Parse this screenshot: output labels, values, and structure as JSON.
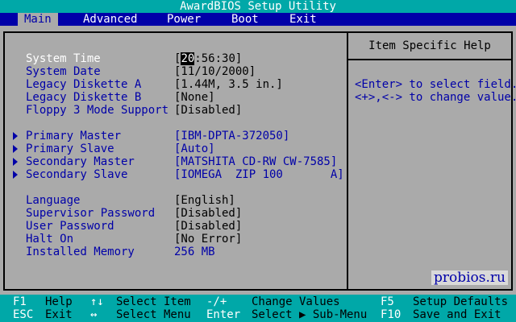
{
  "title": "AwardBIOS Setup Utility",
  "menu": [
    {
      "label": "Main",
      "active": true
    },
    {
      "label": "Advanced"
    },
    {
      "label": "Power"
    },
    {
      "label": "Boot"
    },
    {
      "label": "Exit"
    }
  ],
  "settings": {
    "system_time": {
      "label": "System Time",
      "cursor": "20",
      "rest": ":56:30]",
      "open": "["
    },
    "system_date": {
      "label": "System Date",
      "value": "[11/10/2000]"
    },
    "legacy_a": {
      "label": "Legacy Diskette A",
      "value": "[1.44M, 3.5 in.]"
    },
    "legacy_b": {
      "label": "Legacy Diskette B",
      "value": "[None]"
    },
    "floppy3": {
      "label": "Floppy 3 Mode Support",
      "value": "[Disabled]"
    },
    "primary_master": {
      "label": "Primary Master",
      "value": "[IBM-DPTA-372050]"
    },
    "primary_slave": {
      "label": "Primary Slave",
      "value": "[Auto]"
    },
    "secondary_master": {
      "label": "Secondary Master",
      "value": "[MATSHITA CD-RW CW-7585]"
    },
    "secondary_slave": {
      "label": "Secondary Slave",
      "value": "[IOMEGA  ZIP 100       A]"
    },
    "language": {
      "label": "Language",
      "value": "[English]"
    },
    "supervisor_password": {
      "label": "Supervisor Password",
      "value": "[Disabled]"
    },
    "user_password": {
      "label": "User Password",
      "value": "[Disabled]"
    },
    "halt_on": {
      "label": "Halt On",
      "value": "[No Error]"
    },
    "installed_memory": {
      "label": "Installed Memory",
      "value": "256 MB"
    }
  },
  "help": {
    "title": "Item Specific Help",
    "line1": "<Enter> to select field.",
    "line2": "<+>,<-> to change value."
  },
  "watermark": "probios.ru",
  "footer": {
    "f1_key": "F1",
    "f1_desc": "Help",
    "arrows_ud": "↑↓",
    "select_item": "Select Item",
    "minus_plus": "-/+",
    "change_values": "Change Values",
    "f5_key": "F5",
    "f5_desc": "Setup Defaults",
    "esc_key": "ESC",
    "esc_desc": "Exit",
    "arrows_lr": "↔",
    "select_menu": "Select Menu",
    "enter_key": "Enter",
    "select_sub": "Select ▶ Sub-Menu",
    "f10_key": "F10",
    "f10_desc": "Save and Exit"
  },
  "colors": {
    "background": "#aaaaaa",
    "menu_bar": "#0000a8",
    "title_bar": "#00a8a8",
    "label_text": "#0000a8",
    "value_text": "#000000",
    "selected_text": "#ffffff"
  }
}
